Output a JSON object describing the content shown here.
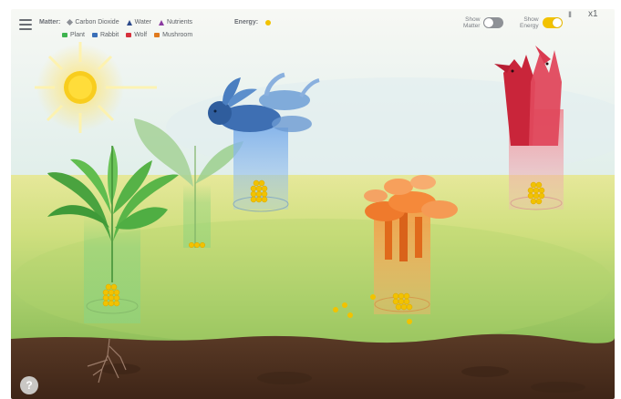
{
  "legend": {
    "matter_label": "Matter:",
    "matter_items": [
      {
        "icon": "diamond-icon",
        "label": "Carbon Dioxide",
        "color": "#8c9096"
      },
      {
        "icon": "water-triangle-icon",
        "label": "Water",
        "color": "#2c4a8a"
      },
      {
        "icon": "nutrients-triangle-icon",
        "label": "Nutrients",
        "color": "#8a3aa0"
      }
    ],
    "energy_label": "Energy:",
    "organism_items": [
      {
        "label": "Plant",
        "color": "#3fb34f"
      },
      {
        "label": "Rabbit",
        "color": "#3a6fb8"
      },
      {
        "label": "Wolf",
        "color": "#d6303c"
      },
      {
        "label": "Mushroom",
        "color": "#e07a1e"
      }
    ]
  },
  "controls": {
    "show_matter_label_1": "Show",
    "show_matter_label_2": "Matter",
    "show_matter_on": false,
    "show_energy_label_1": "Show",
    "show_energy_label_2": "Energy",
    "show_energy_on": true,
    "pause_symbol": "II",
    "speed_label": "x1",
    "help_symbol": "?"
  },
  "colors": {
    "energy": "#f2c200",
    "toggle_on": "#f2c200",
    "toggle_off": "#8e9196",
    "soil": "#4a2e1e"
  }
}
